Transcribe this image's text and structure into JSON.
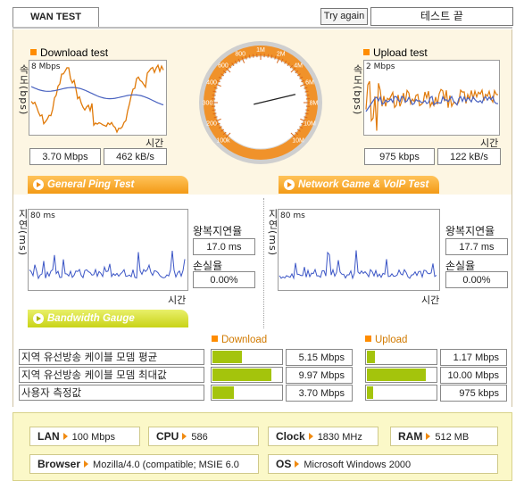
{
  "header": {
    "tab_label": "WAN TEST",
    "try_again_label": "Try again",
    "status_text": "테스트 끝"
  },
  "download": {
    "title": "Download test",
    "y_axis_label": "속도(bps)",
    "y_max_label": "8 Mbps",
    "x_axis_label": "시간",
    "speed_mbps": "3.70 Mbps",
    "speed_kbs": "462 kB/s"
  },
  "upload": {
    "title": "Upload test",
    "y_axis_label": "속도(bps)",
    "y_max_label": "2 Mbps",
    "x_axis_label": "시간",
    "speed_kbps": "975 kbps",
    "speed_kbs": "122 kB/s"
  },
  "gauge": {
    "tick_labels": [
      "100k",
      "200",
      "300",
      "400",
      "600",
      "800",
      "1M",
      "2M",
      "4M",
      "6M",
      "8M",
      "10M",
      "10M"
    ],
    "needle_value_mbps": 3.7,
    "colors": {
      "ring": "#f0922a",
      "face": "#ffffff",
      "ticks": "#d9681b"
    }
  },
  "general_ping": {
    "title": "General Ping Test",
    "y_axis_label": "지연(ms)",
    "y_max_label": "80 ms",
    "x_axis_label": "시간",
    "rtt_label": "왕복지연율",
    "rtt_value": "17.0 ms",
    "loss_label": "손실율",
    "loss_value": "0.00%"
  },
  "game_ping": {
    "title": "Network Game & VoIP Test",
    "y_axis_label": "지연(ms)",
    "y_max_label": "80 ms",
    "x_axis_label": "시간",
    "rtt_label": "왕복지연율",
    "rtt_value": "17.7 ms",
    "loss_label": "손실율",
    "loss_value": "0.00%"
  },
  "bandwidth": {
    "title": "Bandwidth Gauge",
    "download_header": "Download",
    "upload_header": "Upload",
    "rows": [
      {
        "label": "지역 유선방송 케이블 모뎀 평균",
        "download": "5.15 Mbps",
        "download_fill": 0.42,
        "upload": "1.17 Mbps",
        "upload_fill": 0.11
      },
      {
        "label": "지역 유선방송 케이블 모뎀 최대값",
        "download": "9.97 Mbps",
        "download_fill": 0.83,
        "upload": "10.00 Mbps",
        "upload_fill": 0.84
      },
      {
        "label": "사용자 측정값",
        "download": "3.70 Mbps",
        "download_fill": 0.31,
        "upload": "975 kbps",
        "upload_fill": 0.09
      }
    ]
  },
  "system": {
    "lan_label": "LAN",
    "lan_value": "100 Mbps",
    "cpu_label": "CPU",
    "cpu_value": "586",
    "clock_label": "Clock",
    "clock_value": "1830 MHz",
    "ram_label": "RAM",
    "ram_value": "512 MB",
    "browser_label": "Browser",
    "browser_value": "Mozilla/4.0 (compatible; MSIE 6.0",
    "os_label": "OS",
    "os_value": "Microsoft Windows 2000"
  }
}
